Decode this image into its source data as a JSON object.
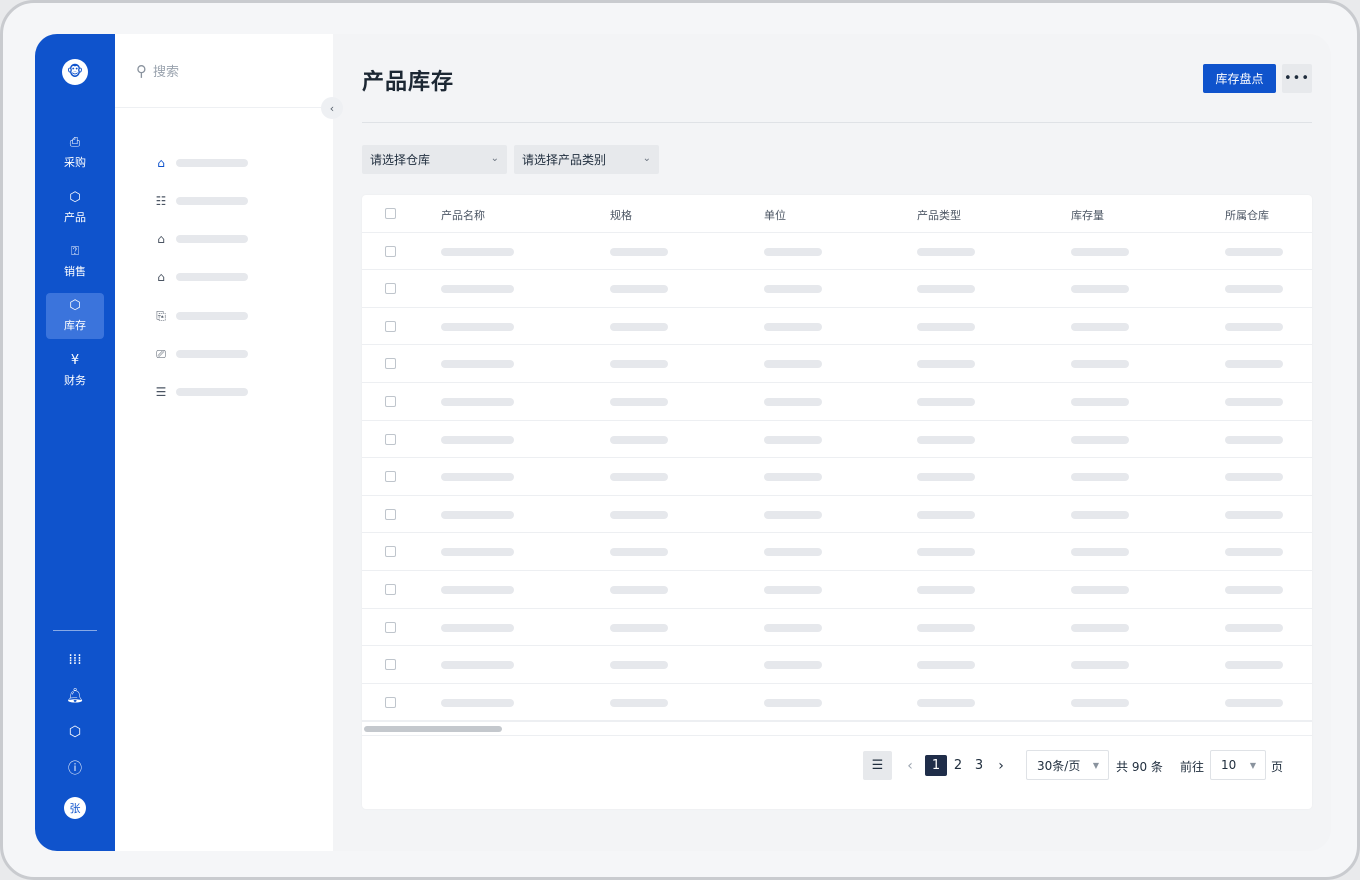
{
  "rail": {
    "logo_icon": "monkey-logo",
    "items": [
      {
        "label": "采购",
        "icon": "purchase-bag-icon"
      },
      {
        "label": "产品",
        "icon": "product-box-icon"
      },
      {
        "label": "销售",
        "icon": "sales-chart-icon"
      },
      {
        "label": "库存",
        "icon": "inventory-box-icon",
        "active": true
      },
      {
        "label": "财务",
        "icon": "finance-yen-icon"
      }
    ],
    "bottom_icons": [
      "apps-grid-icon",
      "bell-icon",
      "settings-hex-icon",
      "help-icon"
    ],
    "avatar_text": "张"
  },
  "subnav": {
    "search_placeholder": "搜索",
    "items": [
      "warehouse-home-icon",
      "calendar-list-icon",
      "warehouse-search-icon",
      "warehouse-settings-icon",
      "transfer-doc-icon",
      "inspect-doc-icon",
      "report-doc-icon"
    ]
  },
  "main": {
    "title": "产品库存",
    "primary_button": "库存盘点",
    "more_button": "•••",
    "filters": {
      "warehouse": "请选择仓库",
      "category": "请选择产品类别"
    },
    "table": {
      "columns": [
        "产品名称",
        "规格",
        "单位",
        "产品类型",
        "库存量",
        "所属仓库"
      ],
      "row_count": 13
    },
    "pagination": {
      "pages": [
        "1",
        "2",
        "3"
      ],
      "current_page": "1",
      "page_size": "30条/页",
      "total": "共 90 条",
      "goto_label": "前往",
      "goto_value": "10",
      "page_suffix": "页"
    }
  },
  "colors": {
    "brand": "#0f53cc",
    "active_rail": "#3b74dc",
    "pager_active": "#1f2d49"
  }
}
